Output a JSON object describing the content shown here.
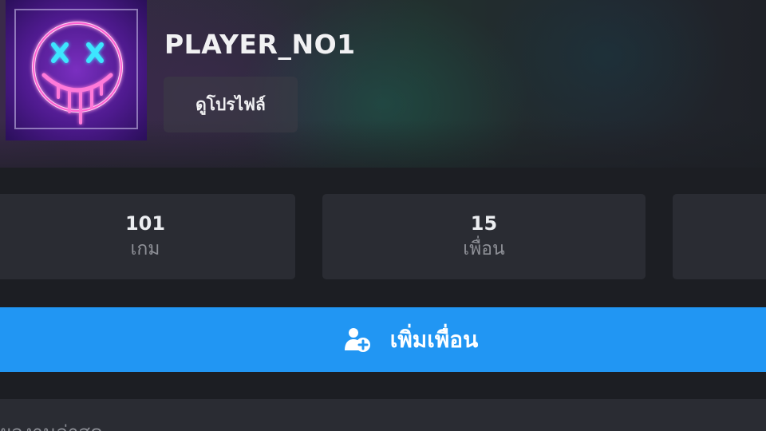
{
  "profile": {
    "player_name": "PLAYER_NO1",
    "view_profile_label": "ดูโปรไฟล์"
  },
  "stats": [
    {
      "value": "101",
      "label": "เกม"
    },
    {
      "value": "15",
      "label": "เพื่อน"
    }
  ],
  "actions": {
    "add_friend_label": "เพิ่มเพื่อน",
    "add_friend_icon": "person-add-icon"
  },
  "section": {
    "title": "ผลงานล่าสุด"
  },
  "colors": {
    "background": "#1c1e23",
    "card": "#2a2c33",
    "accent": "#2196f3"
  }
}
